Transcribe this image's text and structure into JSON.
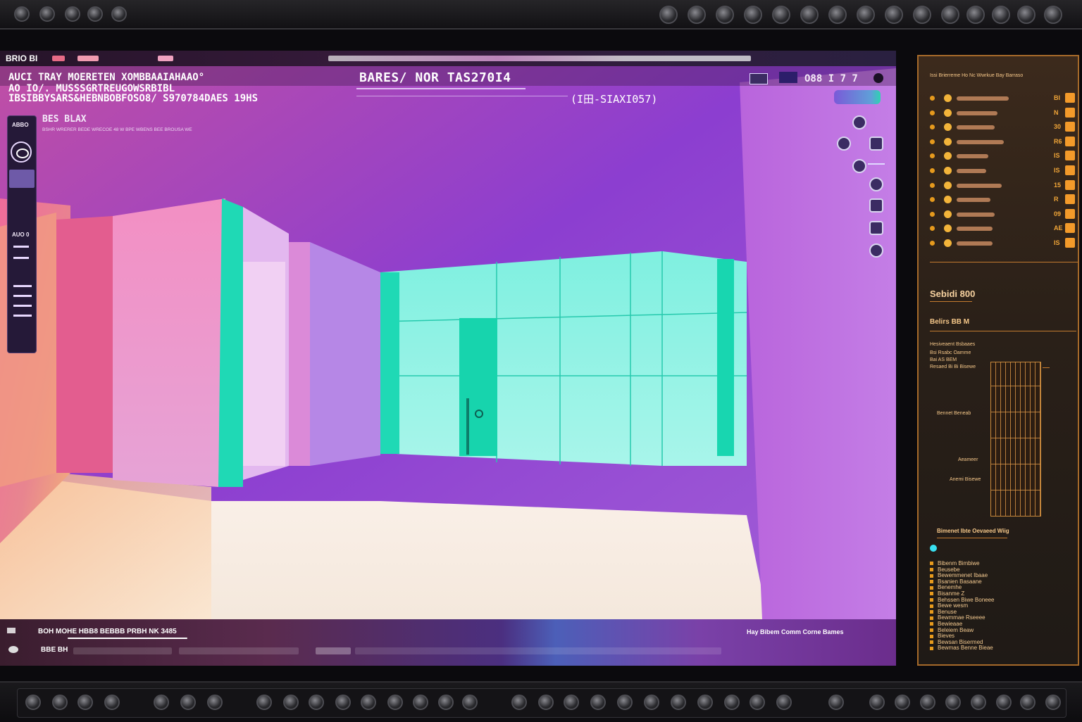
{
  "window": {
    "title": "BRIO BI",
    "heading": "BARES/ NOR TAS270I4",
    "subheading": "(I田-SIAXI057)"
  },
  "overlay": {
    "lines": [
      "AUCI TRAY MOERETEN XOMBBAAIAHAAO°",
      "AO IO/. MUSSSGRTREUGOWSRBIBL",
      "IBSIBBYSARS&HEBNBOBFOSO8/ S970784DAES 19HS"
    ],
    "panel_title": "BES BLAX",
    "panel_caption": "BSHR WRERER BEDE WRECOE 48 W BPE WBENS BEE BROUSA WE"
  },
  "left_panel": {
    "top_label": "ABBO",
    "mid_label": "AUO 0"
  },
  "top_right": {
    "readout": "O88 I 7 7"
  },
  "bottom_toolbar": {
    "left_label": "BOH MOHE HBB8 BEBBB PRBH NK 3485",
    "row2_label": "BBE BH",
    "right_label": "Hay Bibem Comm Corne Bames"
  },
  "side_panel": {
    "header": "Issi Brierreme Ho Nc Wwrkue Bay Barraso",
    "rows": [
      {
        "value": "Bl",
        "track": 0.46
      },
      {
        "value": "N",
        "track": 0.36
      },
      {
        "value": "30",
        "track": 0.34
      },
      {
        "value": "R6",
        "track": 0.42
      },
      {
        "value": "IS",
        "track": 0.28
      },
      {
        "value": "IS",
        "track": 0.26
      },
      {
        "value": "15",
        "track": 0.4
      },
      {
        "value": "R",
        "track": 0.3
      },
      {
        "value": "09",
        "track": 0.34
      },
      {
        "value": "AE",
        "track": 0.32
      },
      {
        "value": "IS",
        "track": 0.32
      }
    ],
    "section_title": "Sebidi 800",
    "section_sub": "Belirs BB M",
    "stats": [
      "Hesiveaent Bsbaaes",
      "Bsi Rsabc Oamme",
      "Bai AS BEM",
      "Resaed Bi Bi Bisewe"
    ],
    "hist_labels": [
      "Bennet Beneab",
      "Aeameer",
      "Anemi Bisewe"
    ],
    "legend_title": "Bimenet Ibte Oevaeed Wiig",
    "legend_items": [
      "Bibenm Bimbiwe",
      "Beusebe",
      "Bewemmenet Ibaae",
      "Bsanien Basaane",
      "Benemhe",
      "Bisanme Z",
      "Behssen Biwe Boneee",
      "Bewe wesm",
      "Benuse",
      "Bewmmae Rseeee",
      "Bewieaae",
      "Beleiem Beaw",
      "Bieves",
      "Bewsan Bisermed",
      "Bewmas Benne Bieae"
    ]
  },
  "colors": {
    "accent": "#f39a2a",
    "panel_border": "#a66a2a",
    "teal": "#1fd9b5",
    "purple": "#9b4fd0"
  }
}
